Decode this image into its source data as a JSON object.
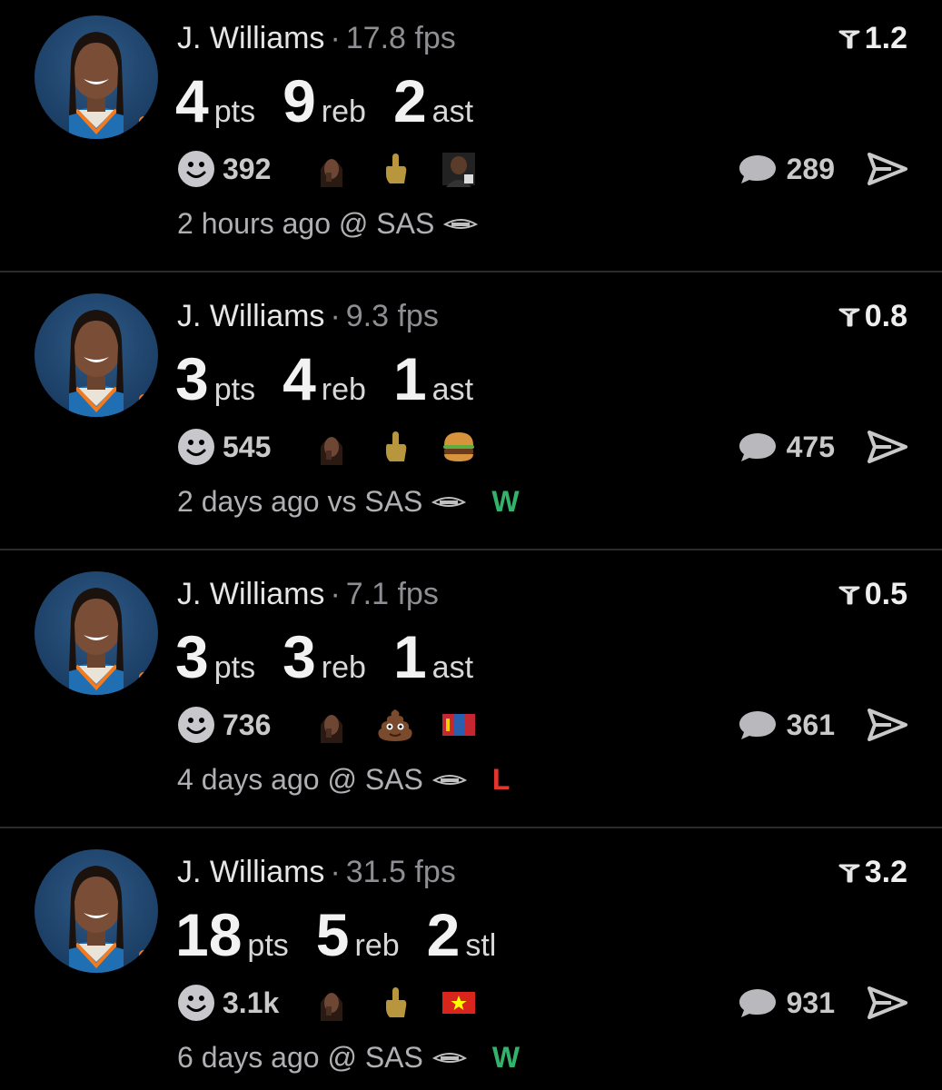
{
  "posts": [
    {
      "player": "J. Williams",
      "fps": "17.8 fps",
      "rating": "1.2",
      "stats": [
        {
          "num": "4",
          "label": "pts"
        },
        {
          "num": "9",
          "label": "reb"
        },
        {
          "num": "2",
          "label": "ast"
        }
      ],
      "reactions_count": "392",
      "reaction_icons": [
        "person-face-emoji",
        "middle-finger-emoji",
        "person-photo-emoji"
      ],
      "comments_count": "289",
      "meta": "2 hours ago @ SAS",
      "result": "",
      "result_type": ""
    },
    {
      "player": "J. Williams",
      "fps": "9.3 fps",
      "rating": "0.8",
      "stats": [
        {
          "num": "3",
          "label": "pts"
        },
        {
          "num": "4",
          "label": "reb"
        },
        {
          "num": "1",
          "label": "ast"
        }
      ],
      "reactions_count": "545",
      "reaction_icons": [
        "person-face-emoji",
        "middle-finger-emoji",
        "burger-emoji"
      ],
      "comments_count": "475",
      "meta": "2 days ago vs SAS",
      "result": "W",
      "result_type": "win"
    },
    {
      "player": "J. Williams",
      "fps": "7.1 fps",
      "rating": "0.5",
      "stats": [
        {
          "num": "3",
          "label": "pts"
        },
        {
          "num": "3",
          "label": "reb"
        },
        {
          "num": "1",
          "label": "ast"
        }
      ],
      "reactions_count": "736",
      "reaction_icons": [
        "person-face-emoji",
        "poop-emoji",
        "mongolia-flag-emoji"
      ],
      "comments_count": "361",
      "meta": "4 days ago @ SAS",
      "result": "L",
      "result_type": "loss"
    },
    {
      "player": "J. Williams",
      "fps": "31.5 fps",
      "rating": "3.2",
      "stats": [
        {
          "num": "18",
          "label": "pts"
        },
        {
          "num": "5",
          "label": "reb"
        },
        {
          "num": "2",
          "label": "stl"
        }
      ],
      "reactions_count": "3.1k",
      "reaction_icons": [
        "person-face-emoji",
        "middle-finger-emoji",
        "vietnam-flag-emoji"
      ],
      "comments_count": "931",
      "meta": "6 days ago @ SAS",
      "result": "W",
      "result_type": "win"
    }
  ],
  "colors": {
    "background": "#000000",
    "win": "#33b26b",
    "loss": "#e5342e",
    "muted": "#8e8e93"
  }
}
